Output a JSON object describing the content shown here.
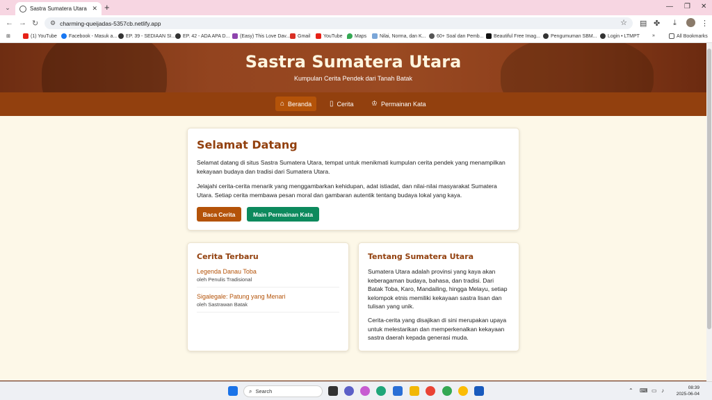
{
  "browser": {
    "tab_title": "Sastra Sumatera Utara - Kumpulan",
    "new_tab_symbol": "+",
    "url": "charming-queijadas-5357cb.netlify.app",
    "bookmarks": [
      {
        "label": "(1) YouTube",
        "color": "#e62117"
      },
      {
        "label": "Facebook - Masuk a...",
        "color": "#1877f2"
      },
      {
        "label": "EP. 39 - SEDIAAN SI...",
        "color": "#333333"
      },
      {
        "label": "EP. 42 - ADA APA D...",
        "color": "#333333"
      },
      {
        "label": "(Easy) This Love Dav...",
        "color": "#8e44ad"
      },
      {
        "label": "Gmail",
        "color": "#d93025"
      },
      {
        "label": "YouTube",
        "color": "#e62117"
      },
      {
        "label": "Maps",
        "color": "#34a853"
      },
      {
        "label": "Nilai, Norma, dan K...",
        "color": "#7aa6d8"
      },
      {
        "label": "60+ Soal dan Pemb...",
        "color": "#555555"
      },
      {
        "label": "Beautiful Free Imag...",
        "color": "#111111"
      },
      {
        "label": "Pengumuman SBM...",
        "color": "#333333"
      },
      {
        "label": "Login • LTMPT",
        "color": "#333333"
      }
    ],
    "bookmarks_more": "»",
    "all_bookmarks": "All Bookmarks"
  },
  "hero": {
    "title": "Sastra Sumatera Utara",
    "subtitle": "Kumpulan Cerita Pendek dari Tanah Batak"
  },
  "nav": {
    "items": [
      {
        "label": "Beranda",
        "icon": "home-icon"
      },
      {
        "label": "Cerita",
        "icon": "book-icon"
      },
      {
        "label": "Permainan Kata",
        "icon": "trophy-icon"
      }
    ]
  },
  "welcome": {
    "heading": "Selamat Datang",
    "paragraph1": "Selamat datang di situs Sastra Sumatera Utara, tempat untuk menikmati kumpulan cerita pendek yang menampilkan kekayaan budaya dan tradisi dari Sumatera Utara.",
    "paragraph2": "Jelajahi cerita-cerita menarik yang menggambarkan kehidupan, adat istiadat, dan nilai-nilai masyarakat Sumatera Utara. Setiap cerita membawa pesan moral dan gambaran autentik tentang budaya lokal yang kaya.",
    "read_button": "Baca Cerita",
    "play_button": "Main Permainan Kata"
  },
  "latest": {
    "heading": "Cerita Terbaru",
    "stories": [
      {
        "title": "Legenda Danau Toba",
        "author": "oleh Penulis Tradisional"
      },
      {
        "title": "Sigalegale: Patung yang Menari",
        "author": "oleh Sastrawan Batak"
      }
    ]
  },
  "about": {
    "heading": "Tentang Sumatera Utara",
    "paragraph1": "Sumatera Utara adalah provinsi yang kaya akan keberagaman budaya, bahasa, dan tradisi. Dari Batak Toba, Karo, Mandailing, hingga Melayu, setiap kelompok etnis memiliki kekayaan sastra lisan dan tulisan yang unik.",
    "paragraph2": "Cerita-cerita yang disajikan di sini merupakan upaya untuk melestarikan dan memperkenalkan kekayaan sastra daerah kepada generasi muda."
  },
  "taskbar": {
    "search_label": "Search",
    "time": "08:39",
    "date": "2025-06-04"
  },
  "colors": {
    "brand_dark": "#92400e",
    "brand_accent": "#b45309",
    "play_green": "#0d8a5d",
    "background": "#fdf8e8"
  }
}
